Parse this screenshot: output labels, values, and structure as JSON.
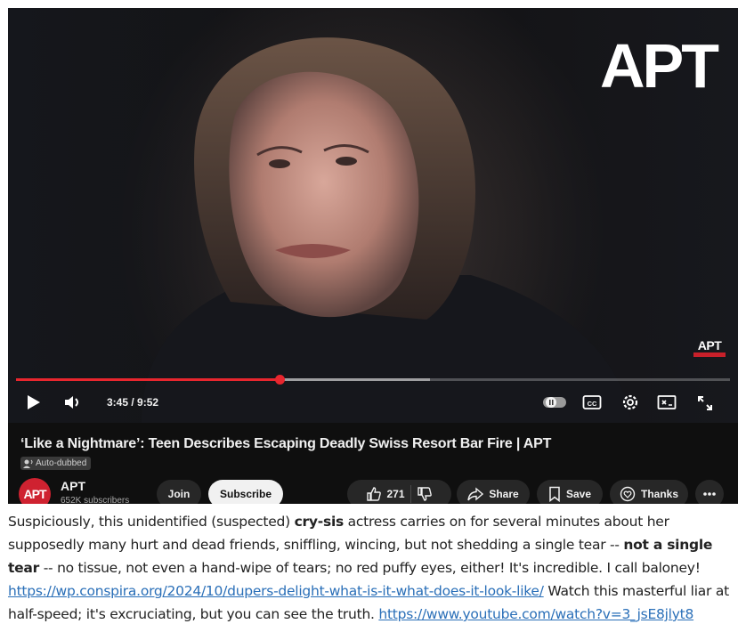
{
  "video": {
    "watermark": "APT",
    "corner_logo": "APT",
    "progress_fraction": 0.37,
    "buffered_fraction": 0.58,
    "time": "3:45 / 9:52"
  },
  "info": {
    "title": "‘Like a Nightmare’: Teen Describes Escaping Deadly Swiss Resort Bar Fire | APT",
    "badge": "Auto-dubbed",
    "channel": {
      "avatar_text": "APT",
      "name": "APT",
      "subscribers": "652K subscribers"
    },
    "join_label": "Join",
    "subscribe_label": "Subscribe",
    "like_count": "271",
    "share_label": "Share",
    "save_label": "Save",
    "thanks_label": "Thanks"
  },
  "caption": {
    "l1a": "Suspiciously, this unidentified (suspected) ",
    "l1b": "cry-sis",
    "l1c": " actress carries on for several minutes about her",
    "l2a": "supposedly many hurt and dead friends, sniffling, wincing, but not shedding a single tear -- ",
    "l2b": "not a single",
    "l3a": "tear",
    "l3b": " -- no tissue, not even a hand-wipe of tears; no red puffy eyes, either!  It's incredible.  I call baloney!",
    "link1": "https://wp.conspira.org/2024/10/dupers-delight-what-is-it-what-does-it-look-like/",
    "l4b": "  Watch this masterful liar at",
    "l5a": "half-speed; it's excruciating, but you can see the truth.  ",
    "link2": "https://www.youtube.com/watch?v=3_jsE8jlyt8"
  },
  "colors": {
    "accent_red": "#e8262e",
    "link": "#2a6fb8",
    "panel": "#0f0f0f"
  }
}
